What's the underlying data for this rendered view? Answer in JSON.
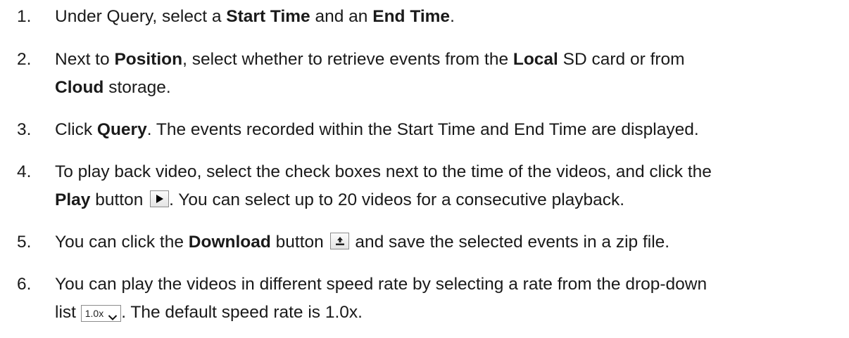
{
  "steps": [
    {
      "num": "1.",
      "t1": "Under Query, select a ",
      "b1": "Start Time",
      "t2": " and an ",
      "b2": "End Time",
      "t3": "."
    },
    {
      "num": "2.",
      "t1": "Next to ",
      "b1": "Position",
      "t2": ", select whether to retrieve events from the ",
      "b2": "Local",
      "t3": " SD card or from",
      "b3": "Cloud",
      "t4": " storage."
    },
    {
      "num": "3.",
      "t1": "Click ",
      "b1": "Query",
      "t2": ". The events recorded within the Start Time and End Time are displayed."
    },
    {
      "num": "4.",
      "t1": "To play back video, select the check boxes next to the time of the videos, and click the",
      "b1": "Play",
      "t2": " button ",
      "t3": ".  You can select up to 20 videos for a consecutive playback."
    },
    {
      "num": "5.",
      "t1": "You can click the ",
      "b1": "Download",
      "t2": " button ",
      "t3": " and save the selected events in a zip file."
    },
    {
      "num": "6.",
      "t1": "You can play the videos in different speed rate by selecting a rate from the drop-down",
      "t2": "list ",
      "t3": ". The default speed rate is 1.0x."
    }
  ],
  "icons": {
    "play": "play-icon",
    "download": "download-icon",
    "dropdown": "chevron-down-icon"
  },
  "rate_dropdown": {
    "value": "1.0x"
  }
}
